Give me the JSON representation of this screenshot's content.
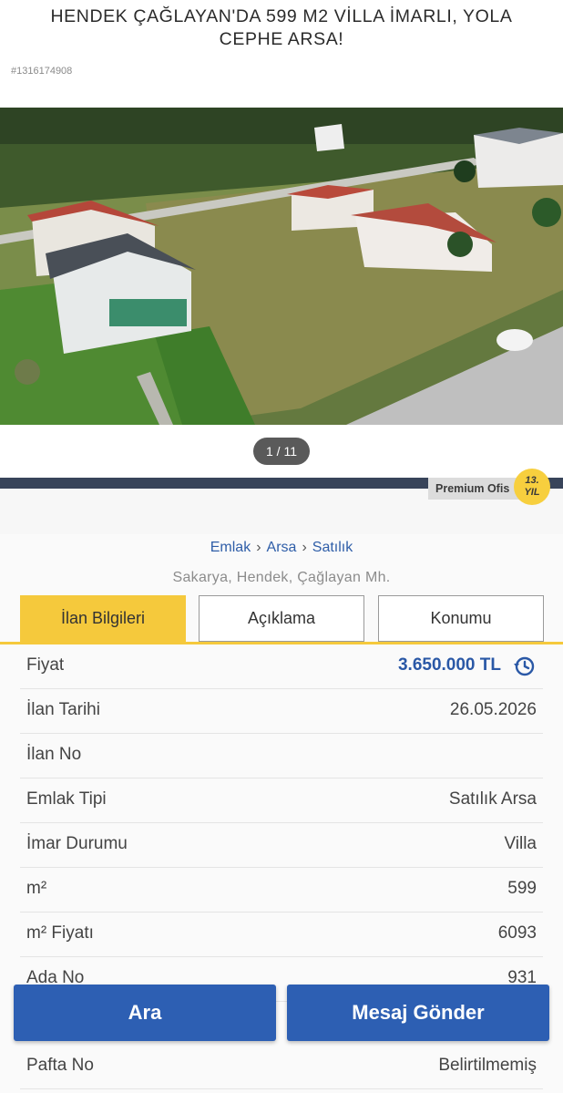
{
  "listing": {
    "title": "HENDEK ÇAĞLAYAN'DA 599 M2 VİLLA İMARLI, YOLA CEPHE ARSA!",
    "id": "#1316174908"
  },
  "gallery": {
    "counter": "1 / 11"
  },
  "seller": {
    "premium_label": "Premium Ofis",
    "year_badge_number": "13.",
    "year_badge_unit": "YIL"
  },
  "breadcrumb": {
    "items": [
      "Emlak",
      "Arsa",
      "Satılık"
    ]
  },
  "location": "Sakarya, Hendek, Çağlayan Mh.",
  "tabs": {
    "items": [
      "İlan Bilgileri",
      "Açıklama",
      "Konumu"
    ],
    "active": "İlan Bilgileri"
  },
  "details": {
    "rows": [
      {
        "label": "Fiyat",
        "value": "3.650.000 TL"
      },
      {
        "label": "İlan Tarihi",
        "value": "26.05.2026"
      },
      {
        "label": "İlan No",
        "value": ""
      },
      {
        "label": "Emlak Tipi",
        "value": "Satılık Arsa"
      },
      {
        "label": "İmar Durumu",
        "value": "Villa"
      },
      {
        "label": "m²",
        "value": "599"
      },
      {
        "label": "m² Fiyatı",
        "value": "6093"
      },
      {
        "label": "Ada No",
        "value": "931"
      }
    ],
    "pafta": {
      "label": "Pafta No",
      "value": "Belirtilmemiş"
    }
  },
  "actions": {
    "call": "Ara",
    "message": "Mesaj Gönder"
  },
  "colors": {
    "accent_yellow": "#f5c93c",
    "primary_blue": "#2d5fb3",
    "price_blue": "#2a58a6"
  }
}
